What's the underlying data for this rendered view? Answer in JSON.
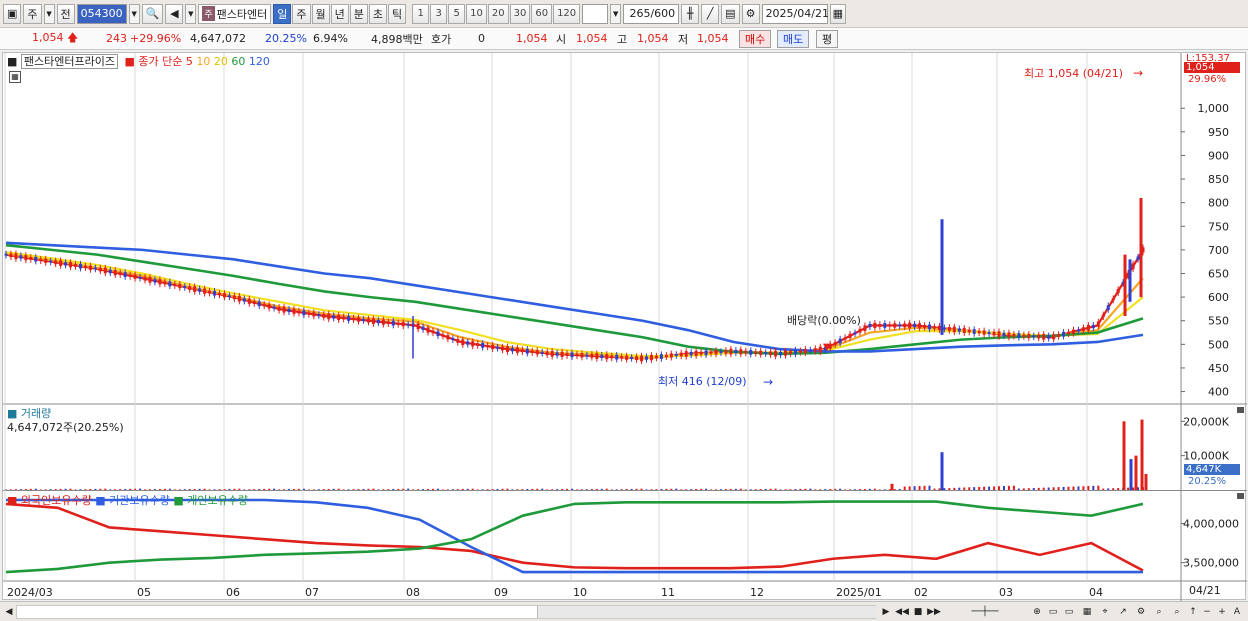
{
  "toolbar": {
    "market_label": "주",
    "prev_label": "전",
    "code": "054300",
    "stock_name": "팬스타엔터",
    "ju_badge": "주",
    "periods": [
      "일",
      "주",
      "월",
      "년",
      "분",
      "초",
      "틱"
    ],
    "active_period": "일",
    "intervals": [
      "1",
      "3",
      "5",
      "10",
      "20",
      "30",
      "60",
      "120"
    ],
    "count": "265",
    "count_total": "/600",
    "date": "2025/04/21"
  },
  "quote": {
    "price": "1,054",
    "change": "243",
    "change_pct": "+29.96%",
    "volume": "4,647,072",
    "vol_ratio": "20.25%",
    "turnover": "6.94%",
    "amount": "4,898백만",
    "hoga_label": "호가",
    "hoga_val": "0",
    "hoga_price": "1,054",
    "open_label": "시",
    "open_val": "1,054",
    "high_label": "고",
    "high_val": "1,054",
    "low_label": "저",
    "low_val": "1,054",
    "buy_label": "매수",
    "sell_label": "매도",
    "eval_label": "평"
  },
  "legend": {
    "name": "팬스타엔터프라이즈",
    "ma_label": "종가 단순",
    "ma_periods": [
      "5",
      "10",
      "20",
      "60",
      "120"
    ],
    "ma_colors": [
      "#e0201a",
      "#f5a623",
      "#f0e020",
      "#1f9a3a",
      "#2f5fe0"
    ],
    "volume_title": "거래량",
    "volume_value": "4,647,072주(20.25%)",
    "holding_series": [
      "외국인보유수량",
      "기관보유수량",
      "개인보유수량"
    ]
  },
  "annotations": {
    "high": "최고 1,054 (04/21)",
    "low": "최저 416 (12/09)",
    "dividend": "배당락(0.00%)",
    "price_tag_top": "L:153.37",
    "price_tag": "1,054",
    "price_pct": "29.96%",
    "vol_tag": "4,647K",
    "vol_pct": "20.25%",
    "last_date": "04/21"
  },
  "chart_data": [
    {
      "type": "line",
      "title": "팬스타엔터프라이즈 일봉",
      "x": [
        "2024/03",
        "05",
        "06",
        "07",
        "08",
        "09",
        "10",
        "11",
        "12",
        "2025/01",
        "02",
        "03",
        "04"
      ],
      "y_ticks": [
        400,
        450,
        500,
        550,
        600,
        650,
        700,
        750,
        800,
        850,
        900,
        950,
        1000
      ],
      "ylim": [
        380,
        1100
      ],
      "series": [
        {
          "name": "5",
          "values": [
            690,
            675,
            660,
            640,
            620,
            600,
            575,
            560,
            550,
            540,
            505,
            490,
            480,
            475,
            470,
            480,
            485,
            480,
            490,
            540,
            540,
            530,
            520,
            515,
            540,
            700
          ]
        },
        {
          "name": "10",
          "values": [
            692,
            678,
            662,
            645,
            622,
            602,
            580,
            565,
            555,
            548,
            515,
            495,
            482,
            478,
            470,
            478,
            484,
            482,
            488,
            525,
            535,
            530,
            522,
            518,
            530,
            640
          ]
        },
        {
          "name": "20",
          "values": [
            695,
            682,
            668,
            650,
            628,
            608,
            590,
            572,
            562,
            552,
            530,
            505,
            490,
            482,
            475,
            476,
            482,
            482,
            486,
            510,
            528,
            528,
            522,
            518,
            522,
            600
          ]
        },
        {
          "name": "60",
          "values": [
            710,
            700,
            690,
            675,
            660,
            645,
            628,
            612,
            600,
            590,
            575,
            560,
            545,
            530,
            515,
            495,
            484,
            480,
            482,
            490,
            500,
            510,
            515,
            518,
            525,
            555
          ]
        },
        {
          "name": "120",
          "values": [
            715,
            710,
            705,
            700,
            690,
            680,
            665,
            650,
            640,
            625,
            610,
            595,
            580,
            565,
            550,
            530,
            505,
            490,
            485,
            485,
            490,
            495,
            498,
            500,
            505,
            520
          ]
        }
      ],
      "annotations": [
        "최고 1,054 (04/21)",
        "최저 416 (12/09)",
        "배당락(0.00%)"
      ]
    },
    {
      "type": "bar",
      "title": "거래량",
      "y_ticks": [
        "10,000K",
        "20,000K"
      ],
      "spikes": [
        {
          "date": "2024/12",
          "value": 1200
        },
        {
          "date": "2025/01",
          "value": 2000
        },
        {
          "date": "2025/02",
          "value": 11000
        },
        {
          "date": "2025/04",
          "value": 20000
        },
        {
          "date": "2025/04/21",
          "value": 4647
        }
      ]
    },
    {
      "type": "line",
      "title": "보유수량",
      "y_ticks": [
        "3,500,000",
        "4,000,000"
      ],
      "series": [
        {
          "name": "외국인보유수량",
          "values": [
            4250000,
            4200000,
            3950000,
            3900000,
            3850000,
            3800000,
            3750000,
            3720000,
            3700000,
            3650000,
            3500000,
            3440000,
            3430000,
            3430000,
            3430000,
            3450000,
            3550000,
            3600000,
            3550000,
            3750000,
            3600000,
            3750000,
            3400000
          ]
        },
        {
          "name": "기관보유수량",
          "values": [
            4300000,
            4300000,
            4300000,
            4300000,
            4300000,
            4300000,
            4270000,
            4200000,
            4050000,
            3700000,
            3380000,
            3380000,
            3380000,
            3380000,
            3380000,
            3380000,
            3380000,
            3380000,
            3380000,
            3380000,
            3380000,
            3380000,
            3380000
          ]
        },
        {
          "name": "개인보유수량",
          "values": [
            3380000,
            3420000,
            3500000,
            3540000,
            3560000,
            3600000,
            3620000,
            3640000,
            3680000,
            3800000,
            4100000,
            4250000,
            4270000,
            4270000,
            4270000,
            4270000,
            4280000,
            4280000,
            4280000,
            4200000,
            4150000,
            4100000,
            4250000
          ]
        }
      ]
    }
  ]
}
